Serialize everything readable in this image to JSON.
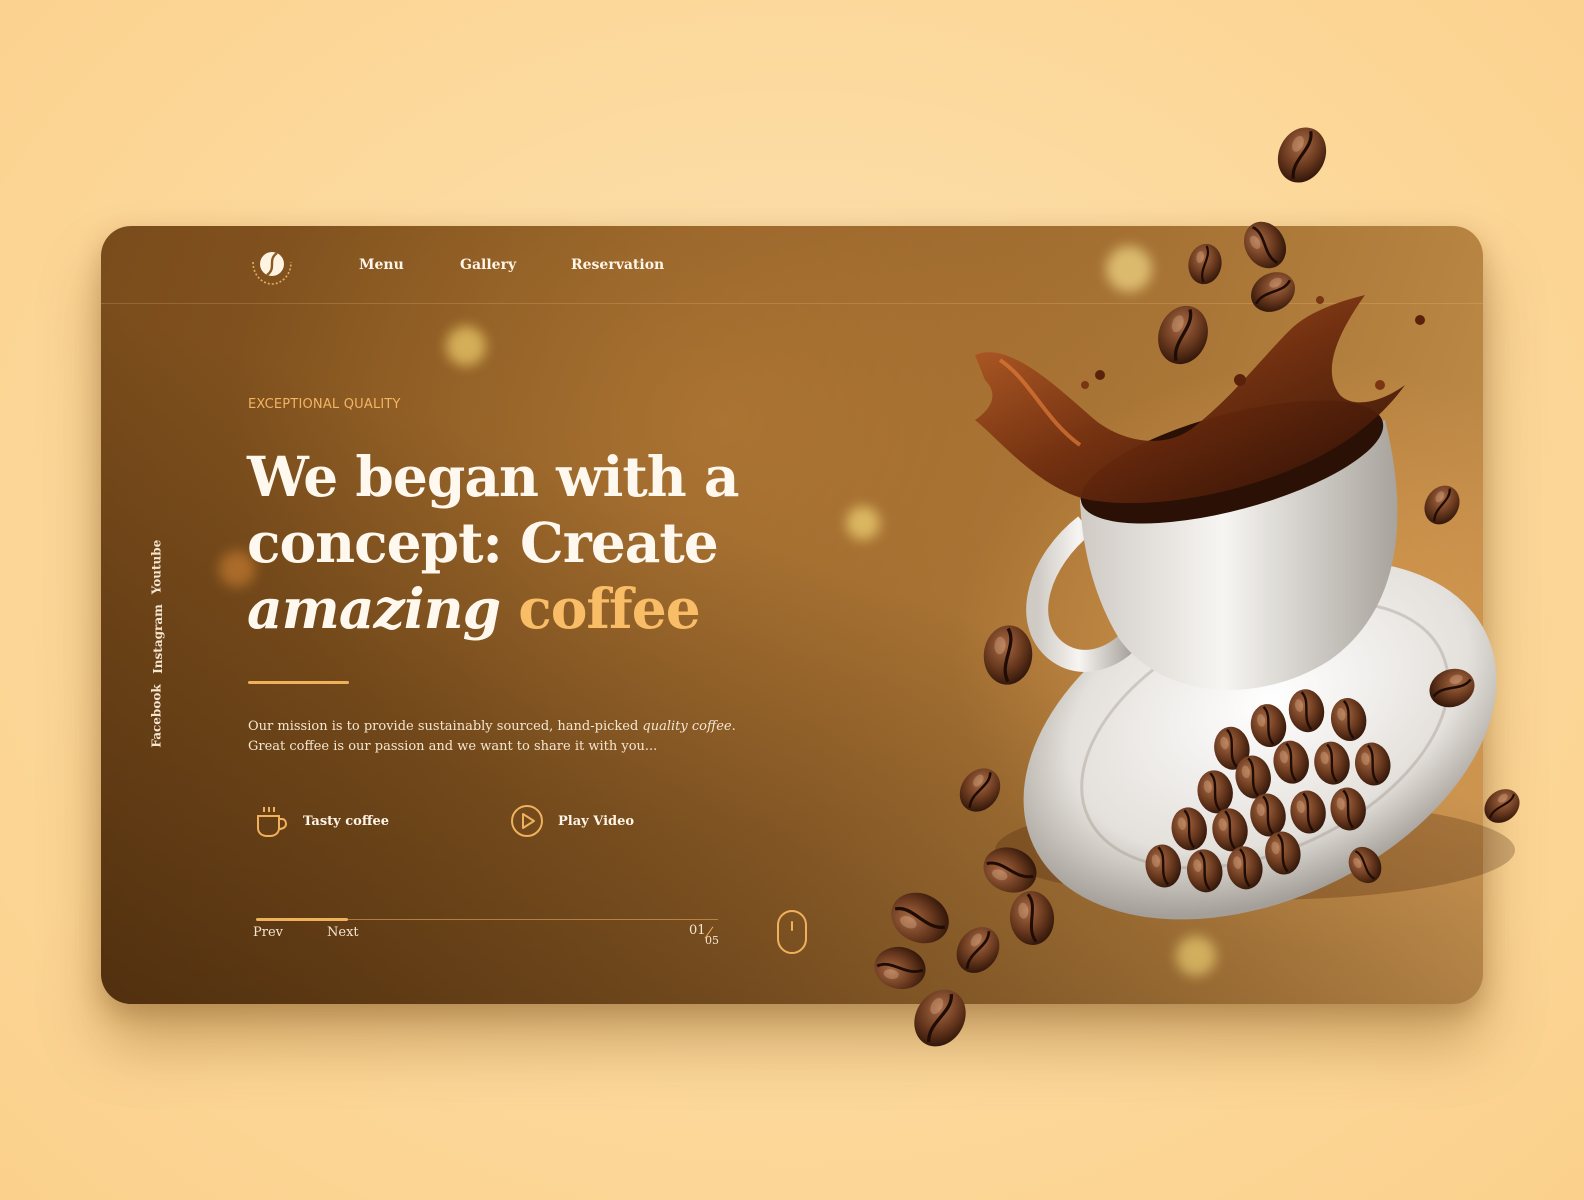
{
  "nav": {
    "logo": "coffee-bean-logo",
    "items": [
      {
        "label": "Menu"
      },
      {
        "label": "Gallery"
      },
      {
        "label": "Reservation"
      }
    ]
  },
  "hero": {
    "eyebrow": "EXCEPTIONAL QUALITY",
    "headline_line1": "We began with a",
    "headline_line2": "concept: Create",
    "headline_italic": "amazing",
    "headline_accent": "coffee",
    "description_part1": "Our mission is to provide sustainably sourced, hand-picked ",
    "description_emphasis": "quality coffee",
    "description_part2": ".",
    "description_line2": "Great coffee is our passion and we want to share it with you..."
  },
  "features": [
    {
      "icon": "coffee-cup-icon",
      "label": "Tasty coffee"
    },
    {
      "icon": "play-circle-icon",
      "label": "Play Video"
    }
  ],
  "social": [
    {
      "label": "Youtube"
    },
    {
      "label": "Instagram"
    },
    {
      "label": "Facebook"
    }
  ],
  "slider": {
    "prev": "Prev",
    "next": "Next",
    "current": "01",
    "total": "05",
    "progress": 0.2
  },
  "colors": {
    "accent": "#f0b15c",
    "headline_accent": "#f8bd66",
    "background": "#fcd696",
    "card": "#8a5a22"
  }
}
